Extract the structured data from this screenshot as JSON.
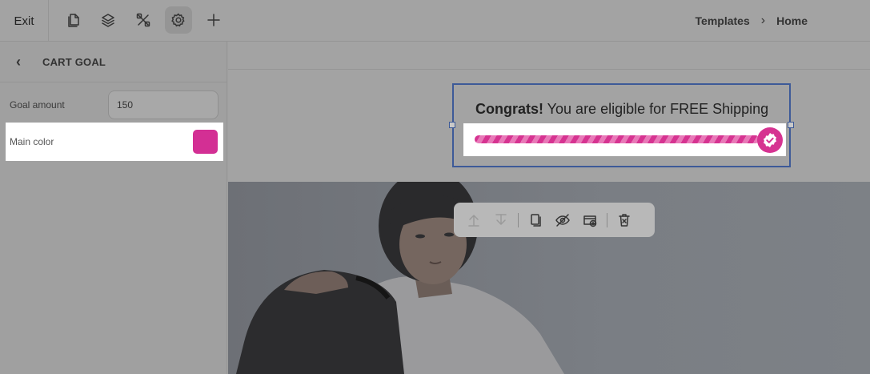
{
  "topbar": {
    "exit_label": "Exit",
    "tools": [
      {
        "icon": "page-icon"
      },
      {
        "icon": "layers-icon"
      },
      {
        "icon": "tools-icon"
      },
      {
        "icon": "settings-icon",
        "active": true
      },
      {
        "icon": "plus-icon"
      }
    ],
    "breadcrumb": [
      "Templates",
      "Home"
    ]
  },
  "sidebar": {
    "title": "CART GOAL",
    "goal_label": "Goal amount",
    "goal_value": "150",
    "color_label": "Main color",
    "main_color": "#d32f94"
  },
  "cart_goal": {
    "bold_text": "Congrats!",
    "message": " You are eligible for FREE Shipping",
    "progress": 1.0,
    "bar_color": "#d63391",
    "badge_icon": "check-badge-icon"
  },
  "floating_toolbar": {
    "buttons": [
      "move-up-icon",
      "move-down-icon",
      "duplicate-icon",
      "hide-icon",
      "add-section-icon",
      "delete-icon"
    ]
  }
}
